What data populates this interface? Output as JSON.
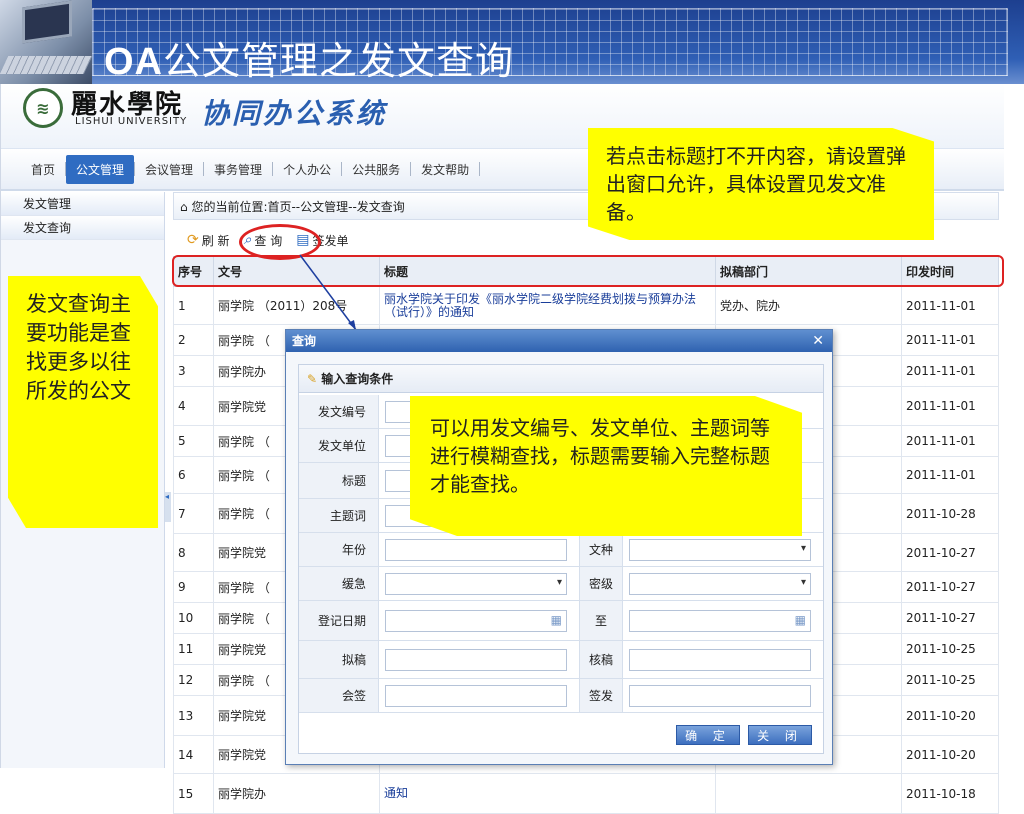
{
  "slide": {
    "title_latin": "OA",
    "title_cn": "公文管理之发文查询"
  },
  "header": {
    "school_cn": "麗水學院",
    "school_en": "LISHUI UNIVERSITY",
    "system_name": "协同办公系统"
  },
  "nav": {
    "items": [
      "首页",
      "公文管理",
      "会议管理",
      "事务管理",
      "个人办公",
      "公共服务",
      "发文帮助"
    ],
    "active": "公文管理"
  },
  "sidebar": {
    "items": [
      "发文管理",
      "发文查询"
    ]
  },
  "breadcrumb": "您的当前位置:首页--公文管理--发文查询",
  "toolbar": {
    "refresh": "刷 新",
    "query": "查 询",
    "sign": "签发单"
  },
  "table": {
    "columns": [
      "序号",
      "文号",
      "标题",
      "拟稿部门",
      "印发时间"
    ],
    "rows": [
      {
        "no": "1",
        "code": "丽学院 （2011）208号",
        "title": "丽水学院关于印发《丽水学院二级学院经费划拨与预算办法（试行）》的通知",
        "dept": "党办、院办",
        "date": "2011-11-01"
      },
      {
        "no": "2",
        "code": "丽学院 （",
        "title": "",
        "dept": "",
        "date": "2011-11-01"
      },
      {
        "no": "3",
        "code": "丽学院办",
        "title": "",
        "dept": "",
        "date": "2011-11-01"
      },
      {
        "no": "4",
        "code": "丽学院党",
        "title": "",
        "dept": "",
        "date": "2011-11-01"
      },
      {
        "no": "5",
        "code": "丽学院 （",
        "title": "",
        "dept": "",
        "date": "2011-11-01"
      },
      {
        "no": "6",
        "code": "丽学院 （",
        "title": "",
        "dept": "",
        "date": "2011-11-01"
      },
      {
        "no": "7",
        "code": "丽学院 （",
        "title": "",
        "dept": "",
        "date": "2011-10-28"
      },
      {
        "no": "8",
        "code": "丽学院党",
        "title": "",
        "dept": "",
        "date": "2011-10-27"
      },
      {
        "no": "9",
        "code": "丽学院 （",
        "title": "",
        "dept": "",
        "date": "2011-10-27"
      },
      {
        "no": "10",
        "code": "丽学院 （",
        "title": "",
        "dept": "",
        "date": "2011-10-27"
      },
      {
        "no": "11",
        "code": "丽学院党",
        "title": "",
        "dept": "",
        "date": "2011-10-25"
      },
      {
        "no": "12",
        "code": "丽学院 （",
        "title": "",
        "dept": "",
        "date": "2011-10-25"
      },
      {
        "no": "13",
        "code": "丽学院党",
        "title": "",
        "dept": "",
        "date": "2011-10-20"
      },
      {
        "no": "14",
        "code": "丽学院党",
        "title": "",
        "dept": "",
        "date": "2011-10-20"
      },
      {
        "no": "15",
        "code": "丽学院办",
        "title": "通知",
        "dept": "",
        "date": "2011-10-18"
      }
    ]
  },
  "dialog": {
    "title": "查询",
    "close": "✕",
    "panel_title": "输入查询条件",
    "labels": {
      "code": "发文编号",
      "unit": "发文单位",
      "title": "标题",
      "keyword": "主题词",
      "year": "年份",
      "doc_type": "文种",
      "urgency": "缓急",
      "secret": "密级",
      "reg_date": "登记日期",
      "to": "至",
      "draft": "拟稿",
      "review": "核稿",
      "cosign": "会签",
      "issue": "签发"
    },
    "confirm": "确 定",
    "cancel": "关 闭"
  },
  "notes": {
    "popup": "若点击标题打不开内容，请设置弹出窗口允许，具体设置见发文准备。",
    "function": "发文查询主要功能是查找更多以往所发的公文",
    "fuzzy": "可以用发文编号、发文单位、主题词等进行模糊查找，标题需要输入完整标题才能查找。"
  }
}
